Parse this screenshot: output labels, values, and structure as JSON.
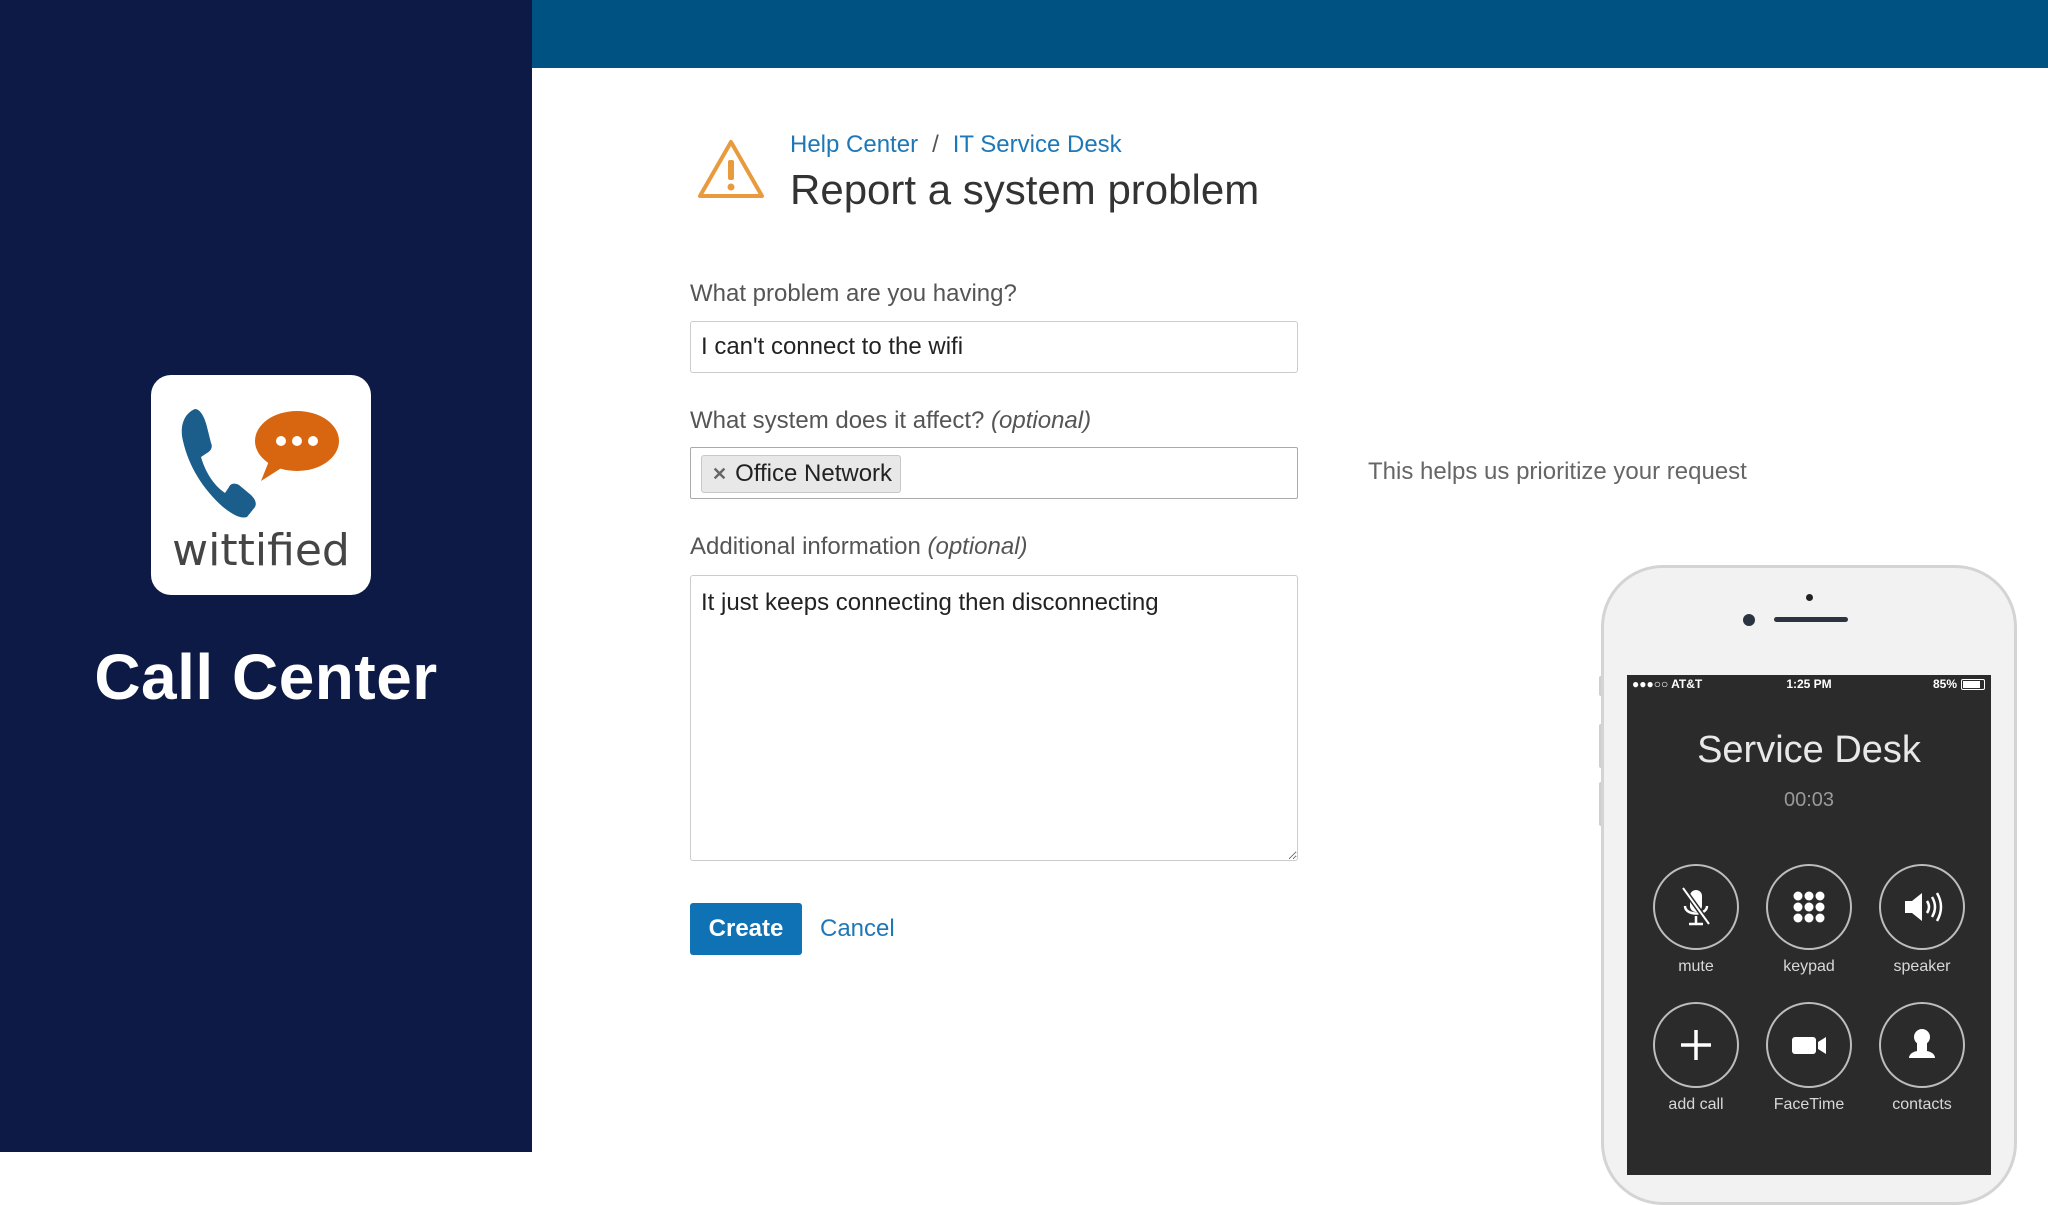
{
  "promo": {
    "logo_word": "wittified",
    "title": "Call Center"
  },
  "header": {
    "breadcrumb": [
      "Help Center",
      "IT Service Desk"
    ],
    "breadcrumb_separator": "/",
    "title": "Report a system problem",
    "icon": "warning-icon"
  },
  "form": {
    "problem": {
      "label": "What problem are you having?",
      "value": "I can't connect to the wifi"
    },
    "system": {
      "label": "What system does it affect?",
      "optional": "(optional)",
      "selected_tags": [
        "Office Network"
      ],
      "help": "This helps us prioritize your request"
    },
    "additional": {
      "label": "Additional information",
      "optional": "(optional)",
      "value": "It just keeps connecting then disconnecting"
    },
    "create_label": "Create",
    "cancel_label": "Cancel"
  },
  "phone": {
    "carrier": "●●●○○ AT&T",
    "time": "1:25 PM",
    "battery": "85%",
    "caller": "Service Desk",
    "timer": "00:03",
    "buttons": [
      {
        "label": "mute",
        "icon": "microphone-muted-icon"
      },
      {
        "label": "keypad",
        "icon": "keypad-icon"
      },
      {
        "label": "speaker",
        "icon": "speaker-icon"
      },
      {
        "label": "add call",
        "icon": "plus-icon"
      },
      {
        "label": "FaceTime",
        "icon": "video-camera-icon"
      },
      {
        "label": "contacts",
        "icon": "contact-person-icon"
      }
    ]
  },
  "colors": {
    "left_panel": "#0c1a45",
    "top_bar": "#005283",
    "link": "#1e78b8",
    "primary_button": "#0f72b4",
    "warning": "#e89a3c",
    "logo_phone": "#1b5e8c",
    "logo_bubble": "#d8650f"
  }
}
